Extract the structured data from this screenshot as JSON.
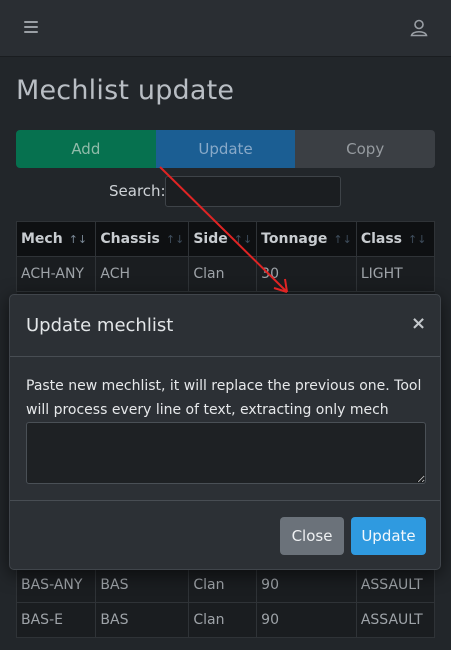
{
  "topbar": {
    "menu_icon": "hamburger-menu-icon",
    "user_icon": "user-icon"
  },
  "page": {
    "title": "Mechlist update"
  },
  "tabs": {
    "add": "Add",
    "update": "Update",
    "copy": "Copy"
  },
  "search": {
    "label": "Search:",
    "value": ""
  },
  "table": {
    "headers": [
      "Mech",
      "Chassis",
      "Side",
      "Tonnage",
      "Class"
    ],
    "rows": [
      [
        "ACH-ANY",
        "ACH",
        "Clan",
        "30",
        "LIGHT"
      ],
      [
        "BAS-ANY",
        "BAS",
        "Clan",
        "90",
        "ASSAULT"
      ],
      [
        "BAS-E",
        "BAS",
        "Clan",
        "90",
        "ASSAULT"
      ]
    ]
  },
  "modal": {
    "title": "Update mechlist",
    "close_icon": "×",
    "text": "Paste new mechlist, it will replace the previous one. Tool will process every line of text, extracting only mech names.",
    "textarea_value": "",
    "close_label": "Close",
    "update_label": "Update"
  },
  "colors": {
    "add": "#06714f",
    "update": "#1b5e93",
    "copy": "#3b3f44",
    "primary_button": "#2f9ae0",
    "annotation_arrow": "#e02424"
  }
}
